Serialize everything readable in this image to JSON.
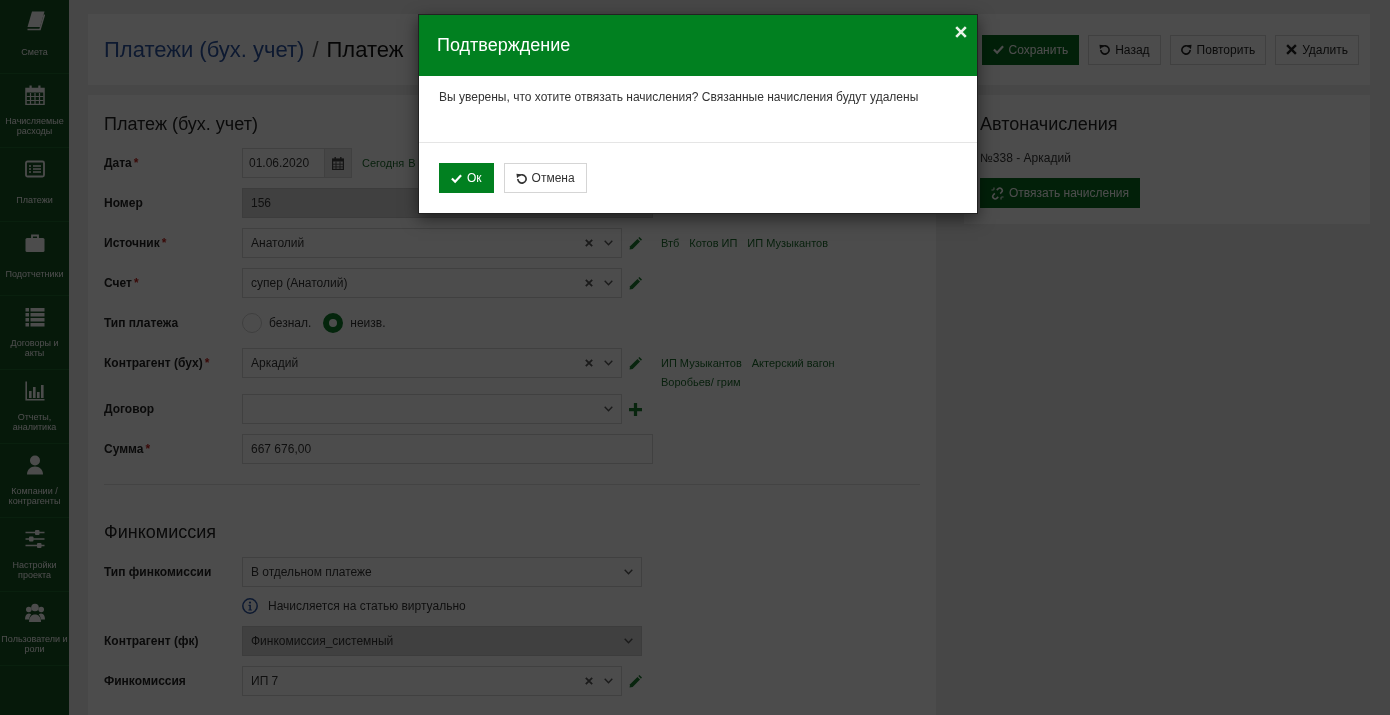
{
  "sidebar": {
    "items": [
      "Смета",
      "Начисляемые расходы",
      "Платежи",
      "Подотчетники",
      "Договоры и акты",
      "Отчеты, аналитика",
      "Компании / контрагенты",
      "Настройки проекта",
      "Пользователи и роли"
    ]
  },
  "header": {
    "breadcrumb": {
      "parent": "Платежи (бух. учет)",
      "separator": "/",
      "current": "Платеж"
    },
    "buttons": [
      {
        "label": "Сохранить",
        "kind": "save"
      },
      {
        "label": "Назад",
        "kind": "back"
      },
      {
        "label": "Повторить",
        "kind": "redo"
      },
      {
        "label": "Удалить",
        "kind": "delete"
      }
    ]
  },
  "payment_form": {
    "title": "Платеж (бух. учет)",
    "fields": [
      {
        "kind": "date",
        "label": "Дата",
        "required_mark": "*",
        "value": "01.06.2020",
        "disabled": false,
        "links": [
          "Сегодня",
          "В"
        ]
      },
      {
        "kind": "text",
        "label": "Номер",
        "value": "156",
        "disabled": true
      },
      {
        "kind": "select",
        "label": "Источник",
        "required_mark": "*",
        "value": "Анатолий",
        "clearable": true,
        "editable": true,
        "addable": false,
        "disabled": false,
        "links": [
          "Втб",
          "Котов ИП",
          "ИП Музыкантов"
        ]
      },
      {
        "kind": "select",
        "label": "Счет",
        "required_mark": "*",
        "value": "супер (Анатолий)",
        "clearable": true,
        "editable": true,
        "addable": false,
        "disabled": false
      },
      {
        "kind": "radio",
        "label": "Тип платежа",
        "disabled": false,
        "options": [
          {
            "label": "безнал.",
            "selected": false
          },
          {
            "label": "неизв.",
            "selected": true
          }
        ]
      },
      {
        "kind": "select",
        "label": "Контрагент (бух)",
        "required_mark": "*",
        "value": "Аркадий",
        "clearable": true,
        "editable": true,
        "addable": false,
        "disabled": false,
        "links": [
          "ИП Музыкантов",
          "Актерский вагон",
          "Воробьев/ грим"
        ]
      },
      {
        "kind": "select",
        "label": "Договор",
        "clearable": false,
        "editable": false,
        "addable": true,
        "disabled": false
      },
      {
        "kind": "text",
        "label": "Сумма",
        "required_mark": "*",
        "value": "667 676,00",
        "disabled": false
      }
    ]
  },
  "commission": {
    "title": "Финкомиссия",
    "fields": [
      {
        "kind": "select",
        "label": "Тип финкомиссии",
        "value": "В отдельном платеже",
        "clearable": false,
        "editable": false,
        "addable": false,
        "disabled": false,
        "hint": "Начисляется на статью виртуально"
      },
      {
        "kind": "select",
        "label": "Контрагент (фк)",
        "value": "Финкомиссия_системный",
        "clearable": false,
        "editable": false,
        "addable": false,
        "disabled": true
      },
      {
        "kind": "select",
        "label": "Финкомиссия",
        "value": "ИП 7",
        "clearable": true,
        "editable": true,
        "addable": false,
        "disabled": false
      }
    ]
  },
  "autocharges": {
    "title": "Автоначисления",
    "entries": [
      "№338 - Аркадий"
    ],
    "button": "Отвязать начисления"
  },
  "dialog": {
    "title": "Подтверждение",
    "message": "Вы уверены, что хотите отвязать начисления? Связанные начисления будут удалены",
    "buttons": [
      {
        "label": "Ок",
        "kind": "confirm"
      },
      {
        "label": "Отмена",
        "kind": "cancel"
      }
    ]
  }
}
